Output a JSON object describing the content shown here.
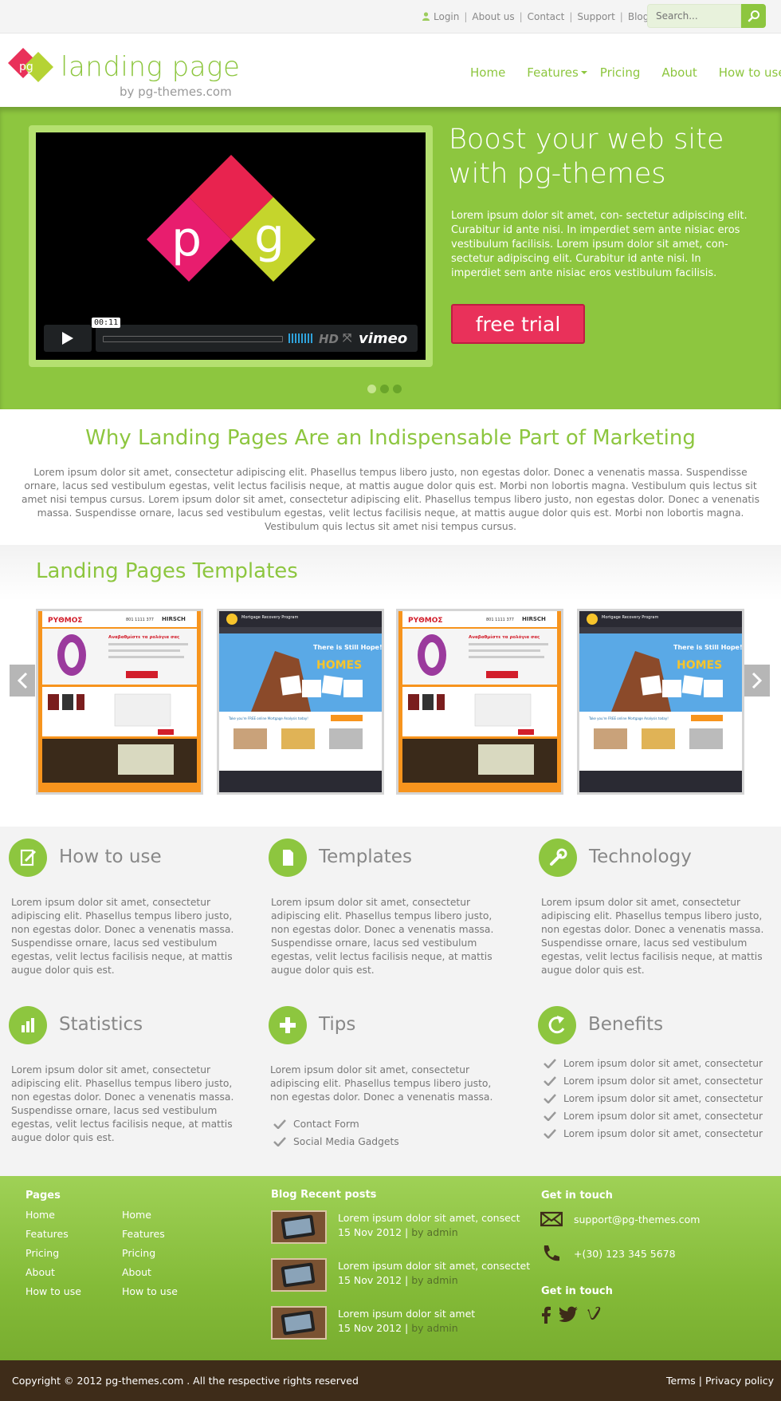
{
  "topbar": {
    "links": [
      "Login",
      "About us",
      "Contact",
      "Support",
      "Blog"
    ],
    "search_placeholder": "Search..."
  },
  "brand": {
    "logo_mark": "pg",
    "name": "landing page",
    "tagline": "by pg-themes.com",
    "colors": {
      "accent": "#8dc63f",
      "pink": "#e9315a",
      "dark": "#3e2c19"
    }
  },
  "nav": {
    "items": [
      "Home",
      "Features",
      "Pricing",
      "About",
      "How to use"
    ]
  },
  "hero": {
    "title": "Boost your web site with pg-themes",
    "text": "Lorem ipsum dolor sit amet, con- sectetur adipiscing elit. Curabitur id ante nisi. In imperdiet sem  ante nisiac eros vestibulum facilisis. Lorem ipsum dolor sit amet, con- sectetur adipiscing elit. Curabitur id ante nisi. In imperdiet sem  ante nisiac eros vestibulum facilisis.",
    "cta": "free trial",
    "video": {
      "time": "00:11",
      "hd": "HD",
      "provider": "vimeo",
      "logo_letters": [
        "p",
        "g"
      ]
    },
    "slides": 3,
    "active_slide": 1
  },
  "intro": {
    "title": "Why Landing Pages Are an Indispensable Part of Marketing",
    "text": "Lorem ipsum dolor sit amet, consectetur adipiscing elit. Phasellus tempus libero justo, non egestas dolor. Donec a venenatis massa. Suspendisse ornare, lacus sed vestibulum egestas, velit lectus facilisis neque, at mattis augue dolor quis est. Morbi non lobortis magna. Vestibulum quis lectus sit amet nisi tempus cursus. Lorem ipsum dolor sit amet, consectetur adipiscing elit. Phasellus tempus libero justo, non egestas dolor. Donec a venenatis massa. Suspendisse ornare, lacus sed vestibulum egestas, velit lectus facilisis neque, at mattis augue dolor quis est. Morbi non lobortis magna. Vestibulum quis lectus sit amet nisi tempus cursus."
  },
  "templates": {
    "title": "Landing Pages Templates",
    "items": [
      {
        "headline": "Αναβαθμίστε τα ρολόγια σας",
        "brand": "ΡΥΘΜΟΣ",
        "partner": "HIRSCH",
        "phone": "801 1111 377"
      },
      {
        "headline": "There is Still Hope!",
        "sub": "HOMES",
        "program": "Mortgage Recovery Program",
        "cta": "Take you're FREE online Mortgage Analysis today!"
      },
      {
        "headline": "Αναβαθμίστε τα ρολόγια σας",
        "brand": "ΡΥΘΜΟΣ",
        "partner": "HIRSCH",
        "phone": "801 1111 377"
      },
      {
        "headline": "There is Still Hope!",
        "sub": "HOMES",
        "program": "Mortgage Recovery Program",
        "cta": "Take you're FREE online Mortgage Analysis today!"
      }
    ]
  },
  "features": {
    "how_to_use": {
      "title": "How to use",
      "text": "Lorem ipsum dolor sit amet, consectetur adipiscing elit. Phasellus tempus libero justo, non egestas dolor. Donec a venenatis massa. Suspendisse ornare, lacus sed vestibulum egestas, velit lectus facilisis neque, at mattis augue dolor quis est."
    },
    "templates": {
      "title": "Templates",
      "text": "Lorem ipsum dolor sit amet, consectetur adipiscing elit. Phasellus tempus libero justo, non egestas dolor. Donec a venenatis massa. Suspendisse ornare, lacus sed vestibulum egestas, velit lectus facilisis neque, at mattis augue dolor quis est."
    },
    "technology": {
      "title": "Technology",
      "text": "Lorem ipsum dolor sit amet, consectetur adipiscing elit. Phasellus tempus libero justo, non egestas dolor. Donec a venenatis massa. Suspendisse ornare, lacus sed vestibulum egestas, velit lectus facilisis neque, at mattis augue dolor quis est."
    },
    "statistics": {
      "title": "Statistics",
      "text": "Lorem ipsum dolor sit amet, consectetur adipiscing elit. Phasellus tempus libero justo, non egestas dolor. Donec a venenatis massa. Suspendisse ornare, lacus sed vestibulum egestas, velit lectus facilisis neque, at mattis augue dolor quis est."
    },
    "tips": {
      "title": "Tips",
      "text": "Lorem ipsum dolor sit amet, consectetur adipiscing elit. Phasellus tempus libero justo, non egestas dolor. Donec a venenatis massa.",
      "items": [
        "Contact Form",
        "Social Media Gadgets"
      ]
    },
    "benefits": {
      "title": "Benefits",
      "items": [
        "Lorem ipsum dolor sit amet, consectetur",
        "Lorem ipsum dolor sit amet, consectetur",
        "Lorem ipsum dolor sit amet, consectetur",
        "Lorem ipsum dolor sit amet, consectetur",
        "Lorem ipsum dolor sit amet, consectetur"
      ]
    }
  },
  "footer": {
    "pages_title": "Pages",
    "pages_col1": [
      "Home",
      "Features",
      "Pricing",
      "About",
      "How to use"
    ],
    "pages_col2": [
      "Home",
      "Features",
      "Pricing",
      "About",
      "How to use"
    ],
    "blog_title": "Blog Recent posts",
    "posts": [
      {
        "title": "Lorem ipsum dolor sit amet, consect",
        "date": "15 Nov 2012",
        "by": "by admin"
      },
      {
        "title": "Lorem ipsum dolor sit amet, consectet",
        "date": "15 Nov 2012",
        "by": "by admin"
      },
      {
        "title": "Lorem ipsum dolor sit amet",
        "date": "15 Nov 2012",
        "by": "by admin"
      }
    ],
    "contact_title": "Get in touch",
    "email": "support@pg-themes.com",
    "phone": "+(30) 123 345 5678",
    "social_title": "Get in touch",
    "social": [
      "facebook-icon",
      "twitter-icon",
      "vimeo-icon"
    ],
    "copyright": "Copyright © 2012 pg-themes.com . All the respective rights reserved",
    "terms": "Terms",
    "privacy": "Privacy policy"
  }
}
